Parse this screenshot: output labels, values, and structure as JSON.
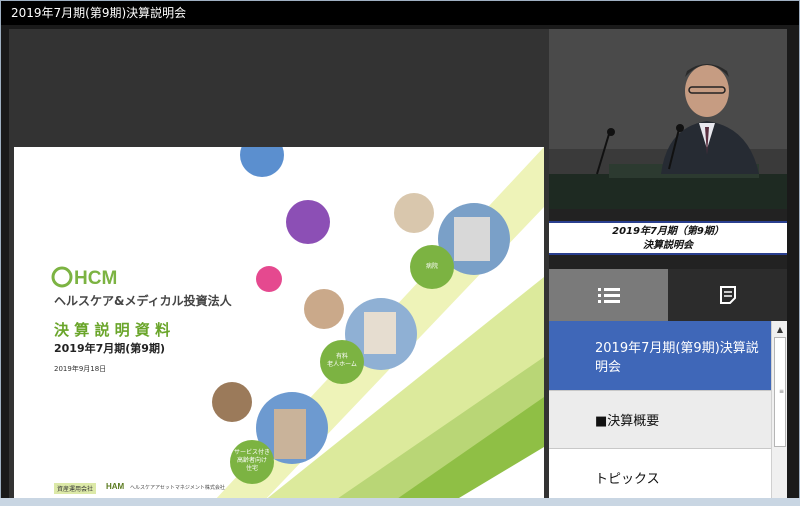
{
  "window": {
    "title": "2019年7月期(第9期)決算説明会"
  },
  "slide": {
    "logo_text": "HCM",
    "company_name": "ヘルスケア&メディカル投資法人",
    "doc_title": "決 算 説 明 資 料",
    "period": "2019年7月期(第9期)",
    "date": "2019年9月18日",
    "circle_labels": {
      "hospital": "病院",
      "nursing_home": "有料\n老人ホーム",
      "service_housing": "サービス付き\n高齢者向け\n住宅"
    },
    "footer_badge": "資産運用会社",
    "footer_logo": "HAM",
    "footer_company": "ヘルスケアアセットマネジメント株式会社",
    "colors": {
      "green": "#7cb342",
      "accent_green": "#6aa52a",
      "olive": "#5a7a1e"
    }
  },
  "video": {
    "caption_line1": "2019年7月期（第9期）",
    "caption_line2": "決算説明会"
  },
  "tabs": {
    "list_icon": "list-icon",
    "notes_icon": "notes-icon"
  },
  "toc": {
    "items": [
      {
        "label": "2019年7月期(第9期)決算説明会",
        "state": "active"
      },
      {
        "label": "■決算概要",
        "state": "grey"
      },
      {
        "label": "トピックス",
        "state": "normal"
      }
    ]
  }
}
